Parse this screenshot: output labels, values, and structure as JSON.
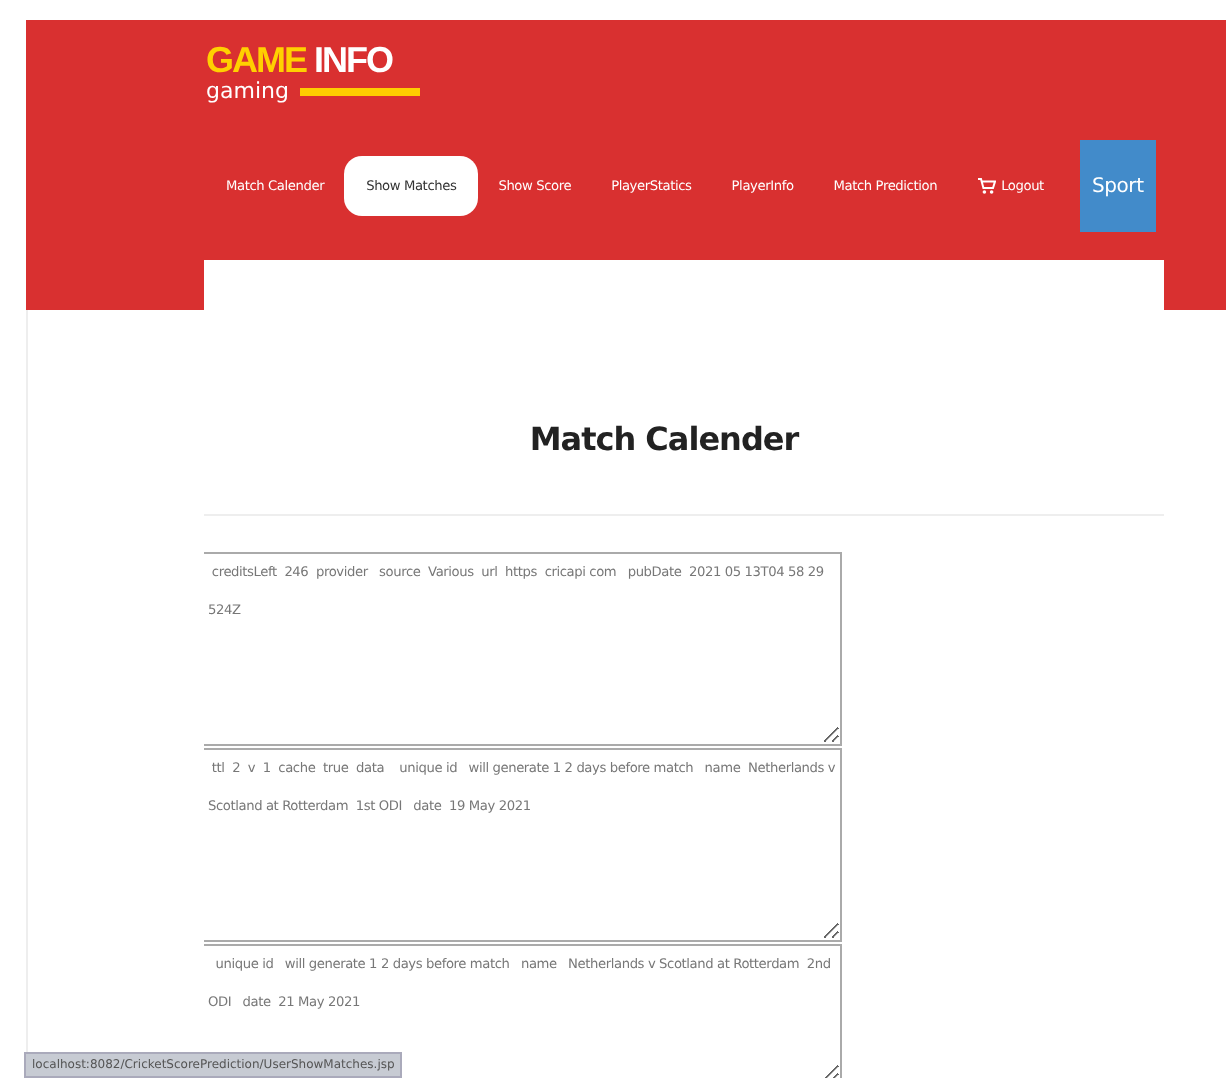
{
  "logo": {
    "word_1": "GAME",
    "word_2": "INFO",
    "tagline": "gaming"
  },
  "nav": [
    {
      "label": "Match Calender",
      "selected": false,
      "kind": "link"
    },
    {
      "label": "Show Matches",
      "selected": true,
      "kind": "link"
    },
    {
      "label": "Show Score",
      "selected": false,
      "kind": "link"
    },
    {
      "label": "PlayerStatics",
      "selected": false,
      "kind": "link"
    },
    {
      "label": "PlayerInfo",
      "selected": false,
      "kind": "link"
    },
    {
      "label": "Match Prediction",
      "selected": false,
      "kind": "link"
    },
    {
      "label": "Logout",
      "selected": false,
      "kind": "cart"
    },
    {
      "label": "Sport",
      "selected": false,
      "kind": "block"
    }
  ],
  "heading": "Match Calender",
  "records": [
    {
      "value": " creditsLeft  246  provider   source  Various  url  https  cricapi com   pubDate  2021 05 13T04 58 29 524Z"
    },
    {
      "value": " ttl  2  v  1  cache  true  data    unique id   will generate 1 2 days before match   name  Netherlands v Scotland at Rotterdam  1st ODI   date  19 May 2021"
    },
    {
      "value": "  unique id   will generate 1 2 days before match   name   Netherlands v Scotland at Rotterdam  2nd ODI   date  21 May 2021"
    }
  ],
  "status_bar": "localhost:8082/CricketScorePrediction/UserShowMatches.jsp"
}
